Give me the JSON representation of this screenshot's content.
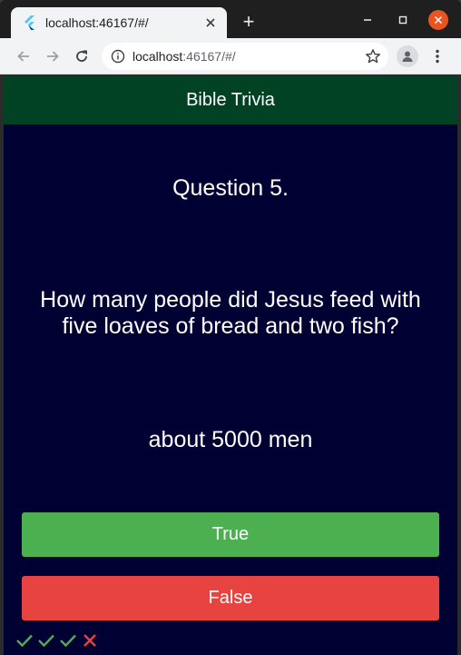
{
  "browser": {
    "tab_title": "localhost:46167/#/",
    "url_host": "localhost",
    "url_rest": ":46167/#/",
    "new_tab_symbol": "+",
    "icons": [
      "flutter-favicon",
      "close-icon",
      "minimize-icon",
      "maximize-icon",
      "window-close-icon",
      "back-arrow-icon",
      "forward-arrow-icon",
      "reload-icon",
      "info-icon",
      "star-icon",
      "profile-icon",
      "kebab-menu-icon"
    ]
  },
  "app": {
    "title": "Bible Trivia",
    "question_number": "Question 5.",
    "question_text": "How many people did Jesus feed with five loaves of bread and two fish?",
    "answer_text": "about 5000 men",
    "true_label": "True",
    "false_label": "False",
    "score_keeper": [
      "correct",
      "correct",
      "correct",
      "incorrect"
    ],
    "colors": {
      "app_bar": "#004223",
      "background": "#000033",
      "true_button": "#4caf50",
      "false_button": "#e74340",
      "check": "#4caf50",
      "cross": "#e74340"
    }
  }
}
